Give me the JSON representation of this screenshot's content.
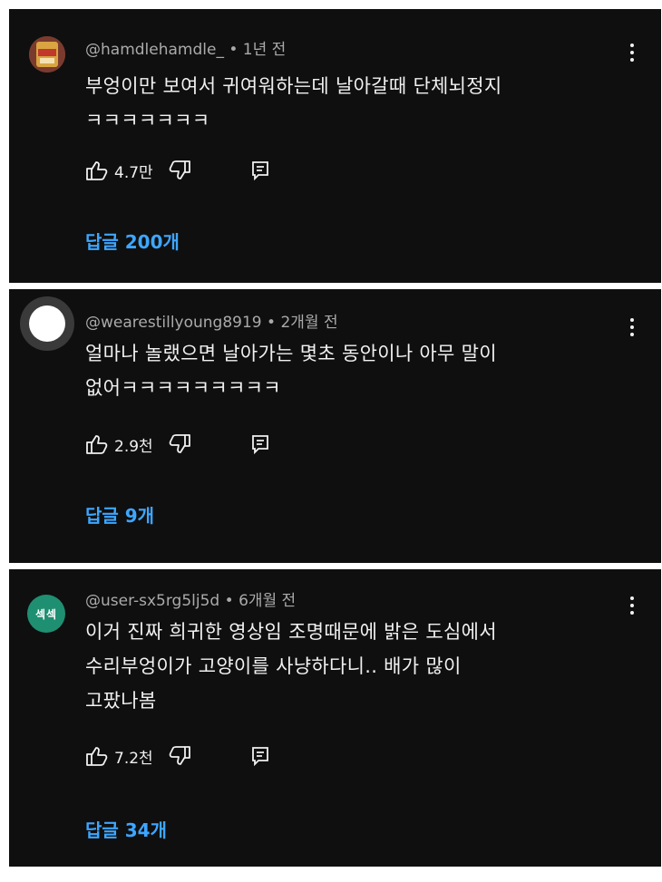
{
  "comments": [
    {
      "handle": "@hamdlehamdle_",
      "time": "1년 전",
      "text_lines": [
        "부엉이만 보여서 귀여워하는데 날아갈때 단체뇌정지",
        "ㅋㅋㅋㅋㅋㅋㅋ"
      ],
      "likes": "4.7만",
      "replies": "답글 200개",
      "avatar": "photo"
    },
    {
      "handle": "@wearestillyoung8919",
      "time": "2개월 전",
      "text_lines": [
        "얼마나 놀랬으면 날아가는 몇초 동안이나 아무 말이",
        "없어ㅋㅋㅋㅋㅋㅋㅋㅋㅋ"
      ],
      "likes": "2.9천",
      "replies": "답글 9개",
      "avatar": "blank"
    },
    {
      "handle": "@user-sx5rg5lj5d",
      "time": "6개월 전",
      "text_lines": [
        "이거 진짜 희귀한 영상임 조명때문에 밝은 도심에서",
        "수리부엉이가 고양이를 사냥하다니.. 배가 많이",
        "고팠나봄"
      ],
      "likes": "7.2천",
      "replies": "답글 34개",
      "avatar": "text",
      "avatar_text": "섹섹"
    }
  ],
  "separator": "•",
  "colors": {
    "background": "#0f0f0f",
    "reply_link": "#3ea6ff",
    "meta": "#aaaaaa"
  },
  "icons": [
    "like-icon",
    "dislike-icon",
    "reply-icon",
    "more-vert-icon"
  ]
}
